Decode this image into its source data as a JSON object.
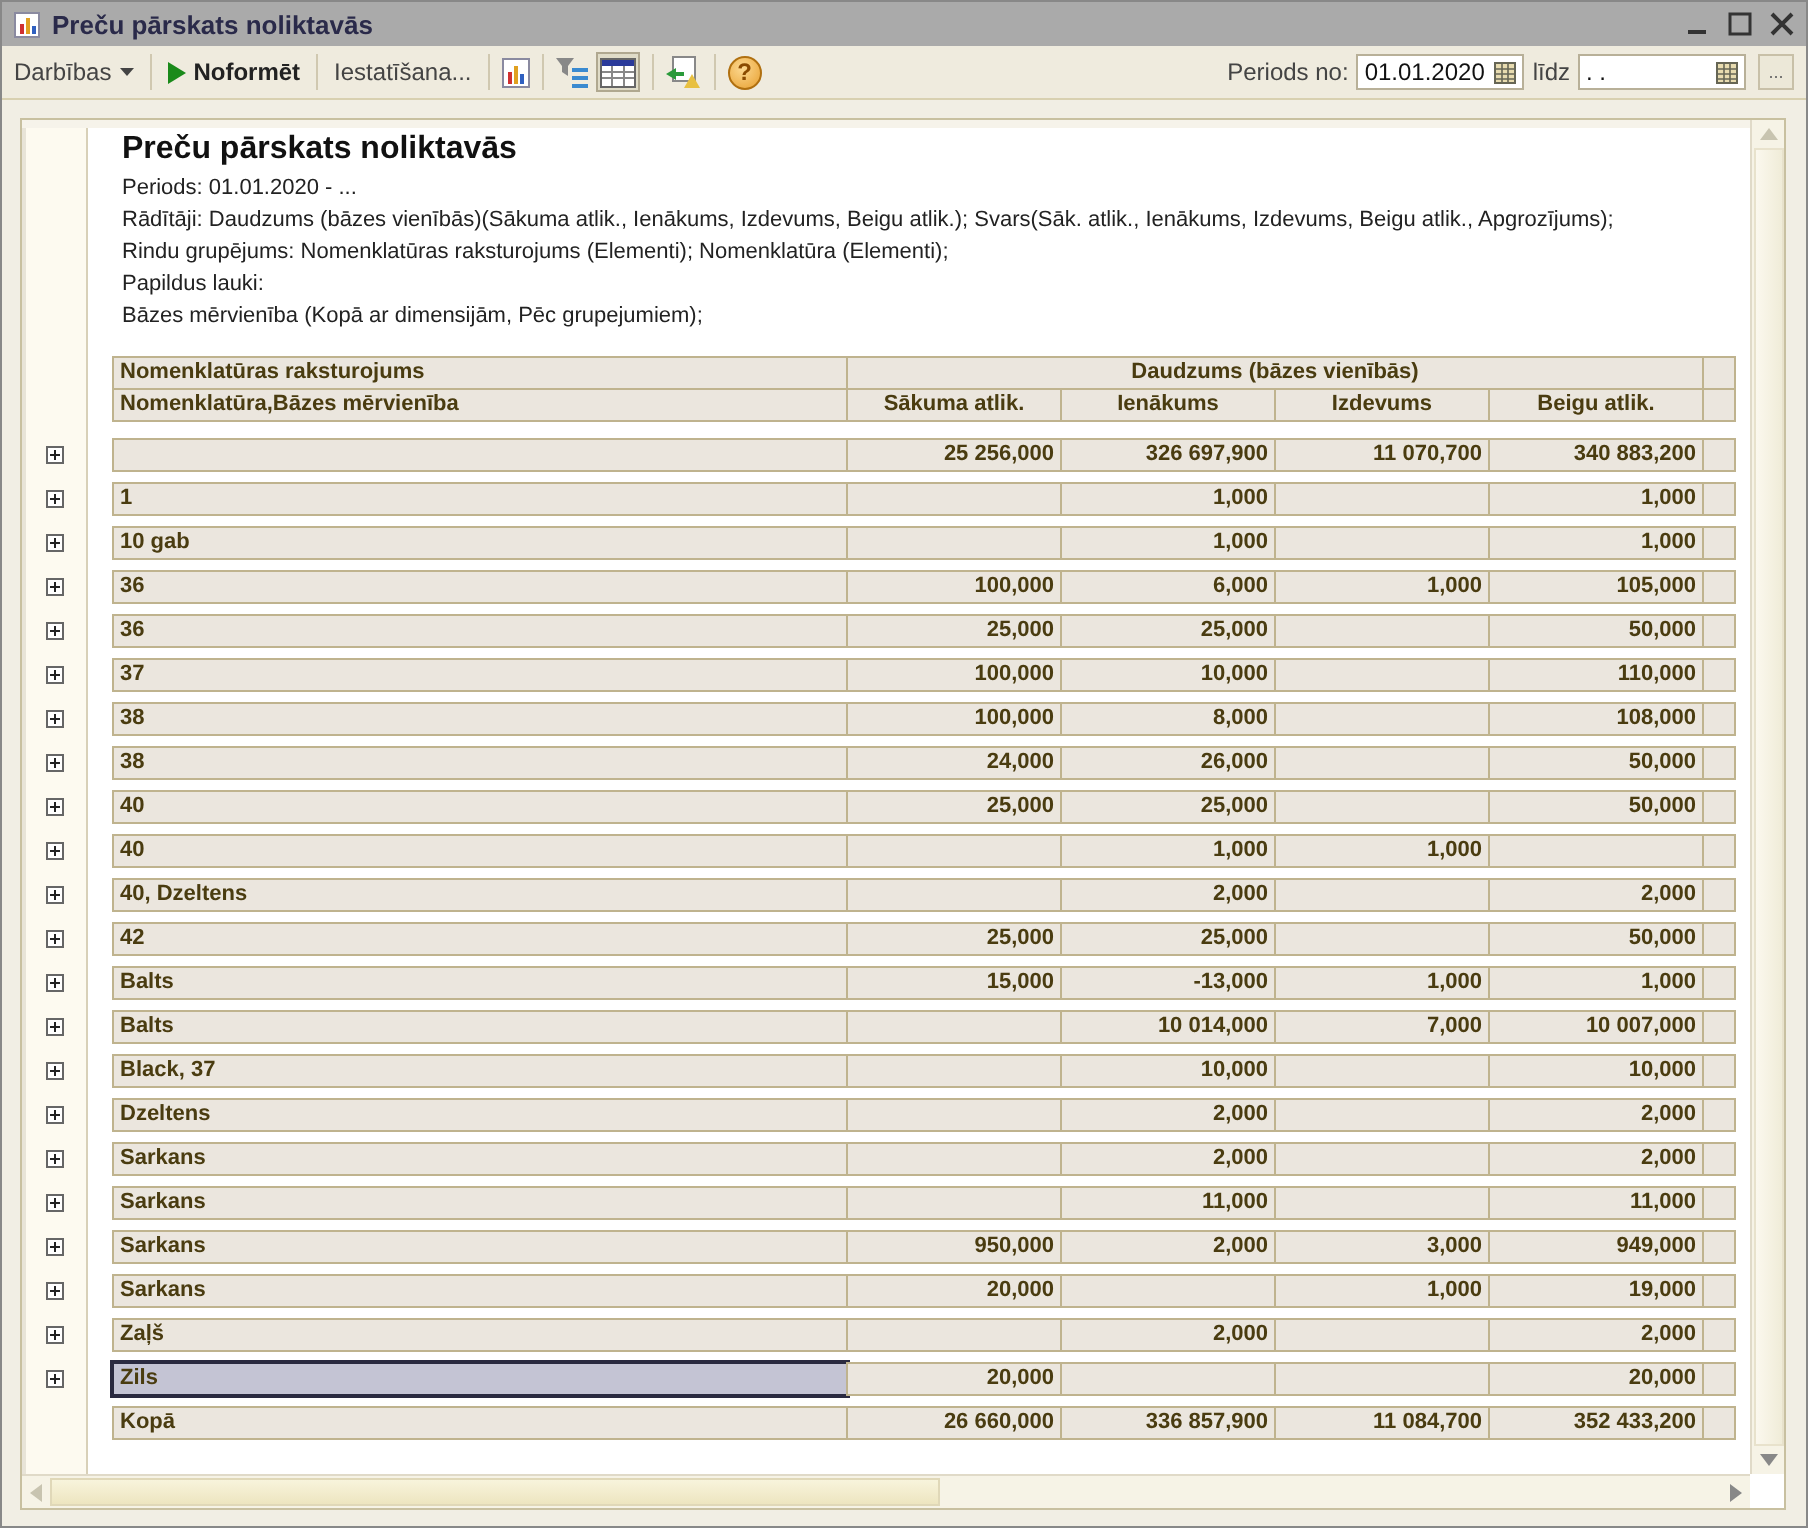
{
  "window": {
    "title": "Preču pārskats noliktavās"
  },
  "toolbar": {
    "actions_menu": "Darbības",
    "run_button": "Noformēt",
    "settings_button": "Iestatīšana...",
    "table_view_on": true,
    "help_button": "?",
    "period_label": "Periods no:",
    "period_from": "01.01.2020",
    "period_to_label": "līdz",
    "period_to": ". .",
    "more_button": "..."
  },
  "report": {
    "title": "Preču pārskats noliktavās",
    "lines": [
      "Periods: 01.01.2020 - ...",
      "Rādītāji:  Daudzums (bāzes vienībās)(Sākuma atlik., Ienākums, Izdevums, Beigu atlik.); Svars(Sāk. atlik., Ienākums, Izdevums, Beigu atlik., Apgrozījums);",
      "Rindu grupējums:  Nomenklatūras raksturojums (Elementi); Nomenklatūra (Elementi);",
      "Papildus lauki:",
      "Bāzes mērvienība (Kopā ar dimensijām, Pēc grupejumiem);"
    ]
  },
  "table": {
    "group_header": "Nomenklatūras raksturojums",
    "row_header": "Nomenklatūra,Bāzes mērvienība",
    "value_group_header": "Daudzums (bāzes vienībās)",
    "columns": [
      "Sākuma atlik.",
      "Ienākums",
      "Izdevums",
      "Beigu atlik."
    ],
    "rows": [
      {
        "start": "25 256,000",
        "receipt": "326 697,900",
        "issue": "11 070,700",
        "end": "340 883,200",
        "expanded": false,
        "selected": false
      },
      {
        "name": "1",
        "receipt": "1,000",
        "end": "1,000",
        "expanded": false,
        "selected": false
      },
      {
        "name": "10 gab",
        "receipt": "1,000",
        "end": "1,000",
        "expanded": false,
        "selected": false
      },
      {
        "name": "36",
        "start": "100,000",
        "receipt": "6,000",
        "issue": "1,000",
        "end": "105,000",
        "expanded": false,
        "selected": false
      },
      {
        "name": "36",
        "start": "25,000",
        "receipt": "25,000",
        "end": "50,000",
        "expanded": false,
        "selected": false
      },
      {
        "name": "37",
        "start": "100,000",
        "receipt": "10,000",
        "end": "110,000",
        "expanded": false,
        "selected": false
      },
      {
        "name": "38",
        "start": "100,000",
        "receipt": "8,000",
        "end": "108,000",
        "expanded": false,
        "selected": false
      },
      {
        "name": "38",
        "start": "24,000",
        "receipt": "26,000",
        "end": "50,000",
        "expanded": false,
        "selected": false
      },
      {
        "name": "40",
        "start": "25,000",
        "receipt": "25,000",
        "end": "50,000",
        "expanded": false,
        "selected": false
      },
      {
        "name": "40",
        "receipt": "1,000",
        "issue": "1,000",
        "expanded": false,
        "selected": false
      },
      {
        "name": "40, Dzeltens",
        "receipt": "2,000",
        "end": "2,000",
        "expanded": false,
        "selected": false
      },
      {
        "name": "42",
        "start": "25,000",
        "receipt": "25,000",
        "end": "50,000",
        "expanded": false,
        "selected": false
      },
      {
        "name": "Balts",
        "start": "15,000",
        "receipt": "-13,000",
        "issue": "1,000",
        "end": "1,000",
        "expanded": false,
        "selected": false
      },
      {
        "name": "Balts",
        "receipt": "10 014,000",
        "issue": "7,000",
        "end": "10 007,000",
        "expanded": false,
        "selected": false
      },
      {
        "name": "Black, 37",
        "receipt": "10,000",
        "end": "10,000",
        "expanded": false,
        "selected": false
      },
      {
        "name": "Dzeltens",
        "receipt": "2,000",
        "end": "2,000",
        "expanded": false,
        "selected": false
      },
      {
        "name": "Sarkans",
        "receipt": "2,000",
        "end": "2,000",
        "expanded": false,
        "selected": false
      },
      {
        "name": "Sarkans",
        "receipt": "11,000",
        "end": "11,000",
        "expanded": false,
        "selected": false
      },
      {
        "name": "Sarkans",
        "start": "950,000",
        "receipt": "2,000",
        "issue": "3,000",
        "end": "949,000",
        "expanded": false,
        "selected": false
      },
      {
        "name": "Sarkans",
        "start": "20,000",
        "issue": "1,000",
        "end": "19,000",
        "expanded": false,
        "selected": false
      },
      {
        "name": "Zaļš",
        "receipt": "2,000",
        "end": "2,000",
        "expanded": false,
        "selected": false
      },
      {
        "name": "Zils",
        "start": "20,000",
        "end": "20,000",
        "expanded": false,
        "selected": true
      }
    ],
    "total": {
      "name": "Kopā",
      "start": "26 660,000",
      "receipt": "336 857,900",
      "issue": "11 084,700",
      "end": "352 433,200"
    }
  }
}
